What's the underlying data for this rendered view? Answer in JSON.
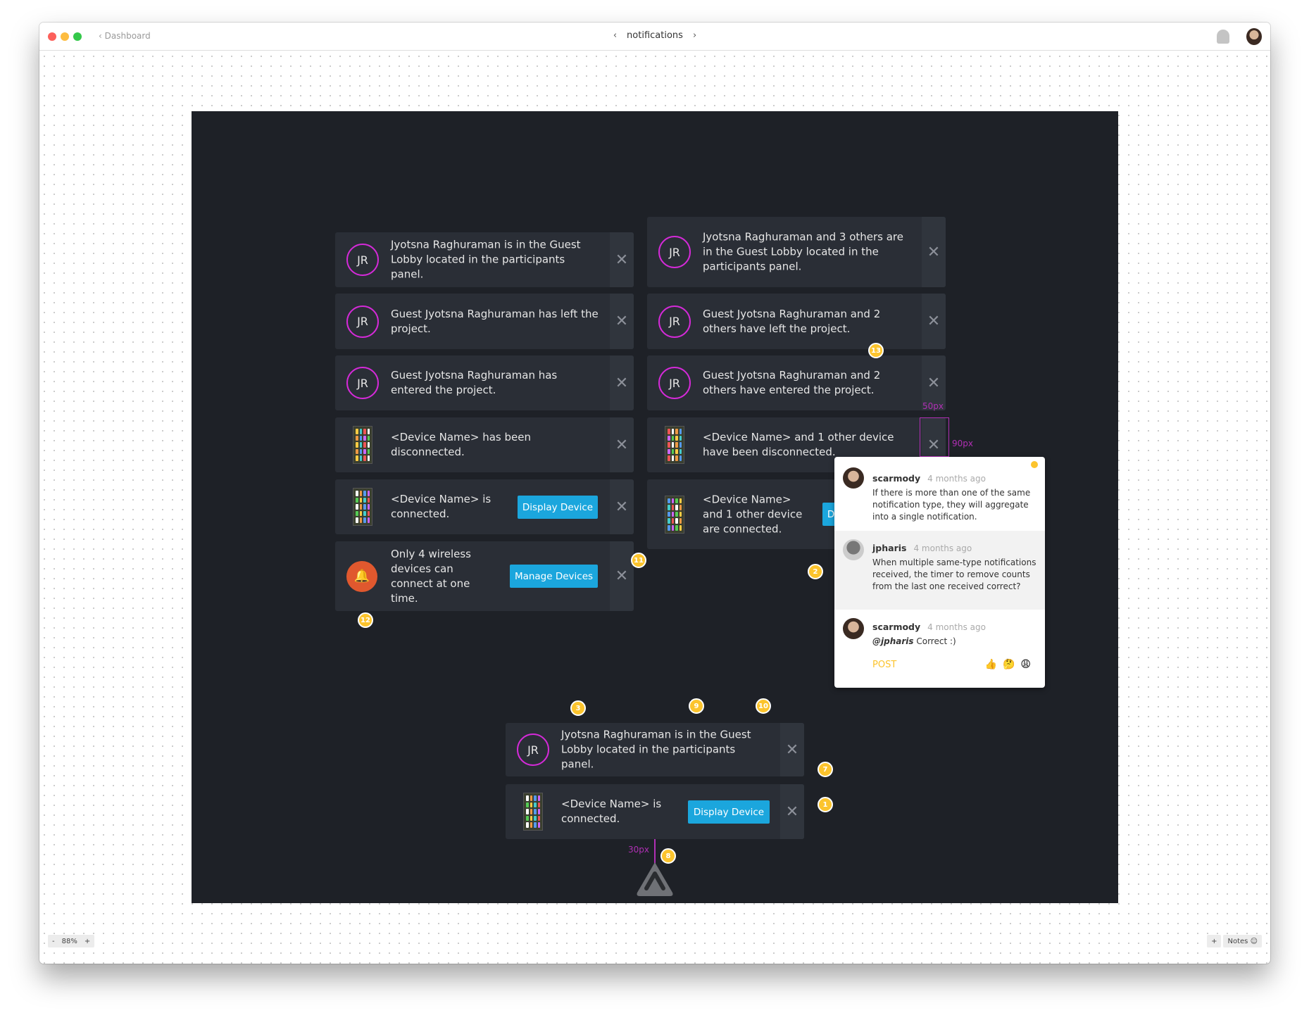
{
  "window": {
    "back_label": "Dashboard",
    "title": "notifications",
    "prev_icon": "chevron-left-icon",
    "next_icon": "chevron-right-icon",
    "zoom": "88%",
    "zoom_out": "-",
    "zoom_in": "+",
    "add": "+",
    "notes_label": "Notes"
  },
  "colors": {
    "accent_button": "#1ba6dd",
    "avatar_ring": "#d42ad8",
    "alert": "#e0582e",
    "badge": "#fcc42d",
    "measure": "#b02fb4",
    "canvas": "#1e2127",
    "card": "#2a2e36"
  },
  "cards": [
    {
      "icon": "avatar",
      "initials": "JR",
      "text": "Jyotsna Raghuraman is in the Guest Lobby located in the participants panel."
    },
    {
      "icon": "avatar",
      "initials": "JR",
      "text": "Guest Jyotsna Raghuraman has left the project."
    },
    {
      "icon": "avatar",
      "initials": "JR",
      "text": "Guest Jyotsna Raghuraman has entered the project."
    },
    {
      "icon": "device",
      "text": "<Device Name> has been disconnected."
    },
    {
      "icon": "device",
      "text": "<Device Name> is connected.",
      "button": "Display Device"
    },
    {
      "icon": "bell",
      "text": "Only 4 wireless devices can connect at one time.",
      "button": "Manage Devices"
    },
    {
      "icon": "avatar",
      "initials": "JR",
      "text": "Jyotsna Raghuraman and 3 others are in the Guest Lobby located in the participants panel."
    },
    {
      "icon": "avatar",
      "initials": "JR",
      "text": "Guest Jyotsna Raghuraman and 2 others have left the project."
    },
    {
      "icon": "avatar",
      "initials": "JR",
      "text": "Guest Jyotsna Raghuraman and 2 others have entered the project."
    },
    {
      "icon": "device",
      "text": "<Device Name> and 1 other device have been disconnected."
    },
    {
      "icon": "device",
      "text": "<Device Name> and 1 other device are connected.",
      "button": "Display Device"
    },
    {
      "icon": "avatar",
      "initials": "JR",
      "text": "Jyotsna Raghuraman is in the Guest Lobby located in the participants panel."
    },
    {
      "icon": "device",
      "text": "<Device Name> is connected.",
      "button": "Display Device"
    }
  ],
  "badges": [
    "13",
    "2",
    "11",
    "12",
    "3",
    "9",
    "10",
    "7",
    "1",
    "8"
  ],
  "measurements": [
    "50px",
    "90px",
    "30px"
  ],
  "comments": [
    {
      "user": "scarmody",
      "time": "4 months ago",
      "text": "If there is more than one of the same notification type, they will aggregate into a single notification."
    },
    {
      "user": "jpharis",
      "time": "4 months ago",
      "text": "When multiple same-type notifications received, the timer to remove counts from the last one received correct?"
    },
    {
      "user": "scarmody",
      "time": "4 months ago",
      "mention": "@jpharis",
      "text": "Correct :)"
    }
  ],
  "comment_actions": {
    "post": "POST",
    "reactions": [
      "👍",
      "🤔",
      "😩"
    ]
  }
}
